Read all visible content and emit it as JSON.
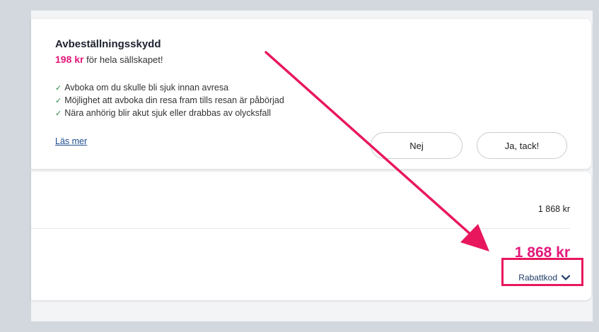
{
  "insurance": {
    "title": "Avbeställningsskydd",
    "price": "198 kr",
    "price_suffix": "för hela sällskapet!",
    "benefits": [
      "Avboka om du skulle bli sjuk innan avresa",
      "Möjlighet att avboka din resa fram tills resan är påbörjad",
      "Nära anhörig blir akut sjuk eller drabbas av olycksfall"
    ],
    "read_more": "Läs mer",
    "no_label": "Nej",
    "yes_label": "Ja, tack!"
  },
  "summary": {
    "row_amount": "1 868 kr",
    "total_amount": "1 868 kr",
    "discount_label": "Rabattkod"
  },
  "colors": {
    "accent": "#e2187a",
    "annotation": "#e8175d",
    "link": "#1d4f91"
  },
  "icons": {
    "check": "check-icon",
    "chevron": "chevron-down-icon"
  }
}
